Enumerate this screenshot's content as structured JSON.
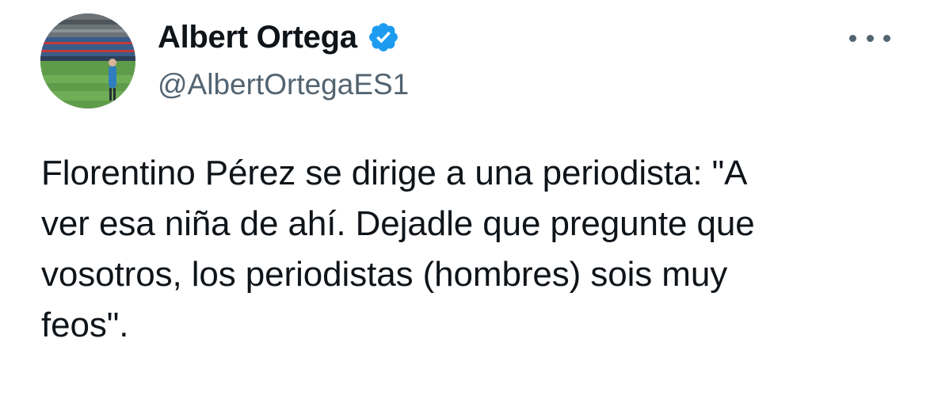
{
  "author": {
    "display_name": "Albert Ortega",
    "handle": "@AlbertOrtegaES1",
    "verified": true,
    "verified_icon": "verified-badge-icon",
    "avatar_description_icon": "avatar"
  },
  "menu": {
    "icon": "more-options-icon"
  },
  "tweet": {
    "text": "Florentino Pérez se dirige a una periodista: \"A\nver esa niña de ahí. Dejadle que pregunte que\nvosotros, los periodistas (hombres) sois muy\nfeos\"."
  },
  "colors": {
    "primary_text": "#0f1419",
    "secondary_text": "#536471",
    "verified_blue": "#1d9bf0",
    "background": "#ffffff"
  }
}
